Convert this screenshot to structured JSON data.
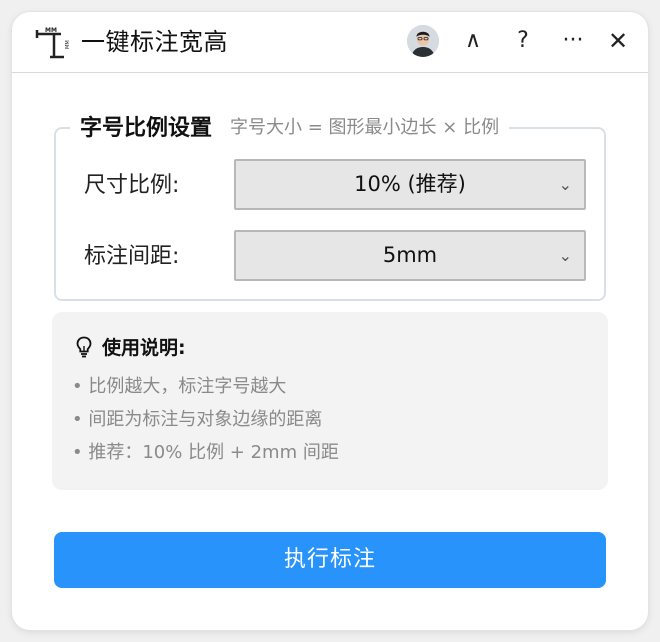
{
  "app": {
    "title": "一键标注宽高",
    "icon_name": "dimension-ruler-icon",
    "icon_label": "MM"
  },
  "titlebar": {
    "collapse_label": "∧",
    "help_label": "?",
    "more_label": "···",
    "close_label": "✕"
  },
  "settings": {
    "legend_title": "字号比例设置",
    "legend_hint": "字号大小 = 图形最小边长 × 比例",
    "rows": [
      {
        "label": "尺寸比例:",
        "value": "10% (推荐)"
      },
      {
        "label": "标注间距:",
        "value": "5mm"
      }
    ]
  },
  "instructions": {
    "title": "使用说明:",
    "icon_name": "lightbulb-icon",
    "lines": [
      "• 比例越大，标注字号越大",
      "• 间距为标注与对象边缘的距离",
      "• 推荐：10% 比例 + 2mm 间距"
    ]
  },
  "action": {
    "execute_label": "执行标注",
    "color": "#2793fb"
  }
}
